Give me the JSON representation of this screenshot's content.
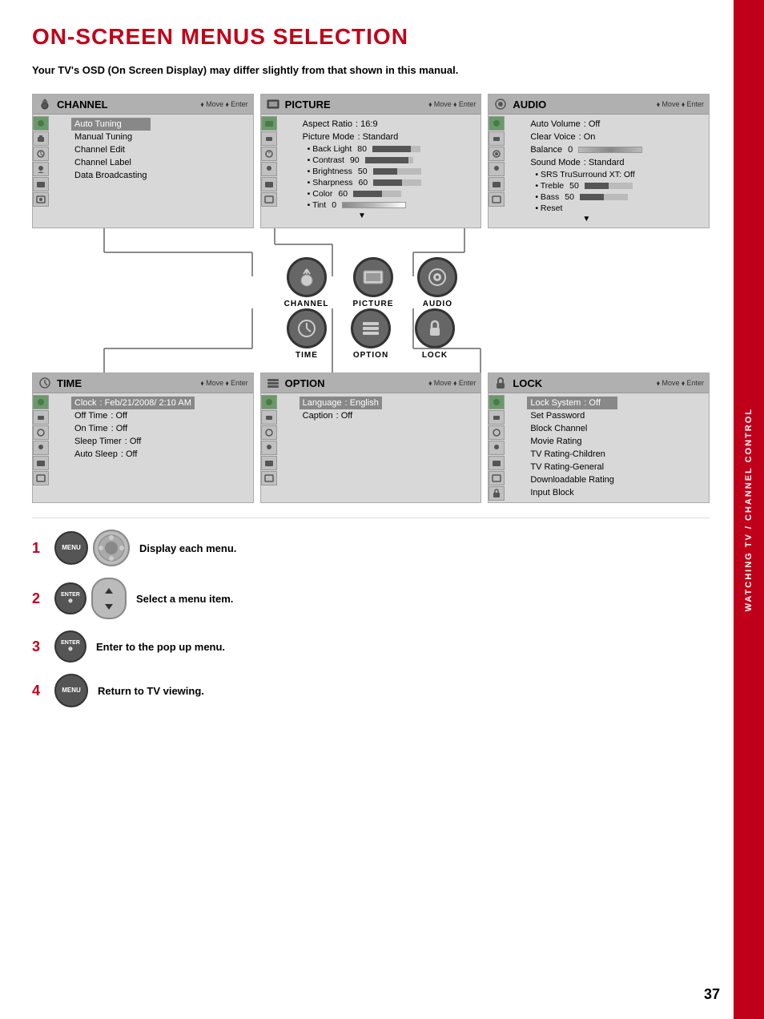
{
  "sidebar": {
    "text": "WATCHING TV / CHANNEL CONTROL"
  },
  "page": {
    "title": "ON-SCREEN MENUS SELECTION",
    "subtitle": "Your TV's OSD (On Screen Display) may differ slightly from that shown in this manual.",
    "page_number": "37"
  },
  "panels": {
    "top_row": [
      {
        "id": "channel",
        "title": "CHANNEL",
        "nav": "Move  Enter",
        "items": [
          {
            "label": "Auto Tuning",
            "value": "",
            "type": "item"
          },
          {
            "label": "Manual Tuning",
            "value": "",
            "type": "item"
          },
          {
            "label": "Channel Edit",
            "value": "",
            "type": "item"
          },
          {
            "label": "Channel Label",
            "value": "",
            "type": "item"
          },
          {
            "label": "Data Broadcasting",
            "value": "",
            "type": "item"
          }
        ]
      },
      {
        "id": "picture",
        "title": "PICTURE",
        "nav": "Move  Enter",
        "items": [
          {
            "label": "Aspect Ratio",
            "value": ": 16:9",
            "type": "header-item"
          },
          {
            "label": "Picture Mode",
            "value": ": Standard",
            "type": "header-item"
          },
          {
            "label": "• Back Light",
            "value": "80",
            "type": "sub",
            "bar": 80
          },
          {
            "label": "• Contrast",
            "value": "90",
            "type": "sub",
            "bar": 90
          },
          {
            "label": "• Brightness",
            "value": "50",
            "type": "sub",
            "bar": 50
          },
          {
            "label": "• Sharpness",
            "value": "60",
            "type": "sub",
            "bar": 60
          },
          {
            "label": "• Color",
            "value": "60",
            "type": "sub",
            "bar": 60
          },
          {
            "label": "• Tint",
            "value": "0",
            "type": "sub-tint"
          }
        ]
      },
      {
        "id": "audio",
        "title": "AUDIO",
        "nav": "Move  Enter",
        "items": [
          {
            "label": "Auto Volume",
            "value": ": Off",
            "type": "header-item"
          },
          {
            "label": "Clear Voice",
            "value": ": On",
            "type": "header-item"
          },
          {
            "label": "Balance",
            "value": "0",
            "type": "balance"
          },
          {
            "label": "Sound Mode",
            "value": ": Standard",
            "type": "header-item"
          },
          {
            "label": "• SRS TruSurround XT: Off",
            "value": "",
            "type": "sub-nobar"
          },
          {
            "label": "• Treble",
            "value": "50",
            "type": "sub",
            "bar": 50
          },
          {
            "label": "• Bass",
            "value": "50",
            "type": "sub",
            "bar": 50
          },
          {
            "label": "• Reset",
            "value": "",
            "type": "sub-nobar"
          }
        ]
      }
    ],
    "middle_icons": [
      {
        "id": "channel",
        "label": "CHANNEL",
        "symbol": "📡"
      },
      {
        "id": "picture",
        "label": "PICTURE",
        "symbol": "🖥"
      },
      {
        "id": "audio",
        "label": "AUDIO",
        "symbol": "🔊"
      }
    ],
    "bottom_icons": [
      {
        "id": "time",
        "label": "TIME",
        "symbol": "⏰"
      },
      {
        "id": "option",
        "label": "OPTION",
        "symbol": "⚙"
      },
      {
        "id": "lock",
        "label": "LOCK",
        "symbol": "🔒"
      }
    ],
    "bottom_row": [
      {
        "id": "time",
        "title": "TIME",
        "nav": "Move  Enter",
        "items": [
          {
            "label": "Clock",
            "value": ": Feb/21/2008/  2:10 AM",
            "type": "header-item"
          },
          {
            "label": "Off Time",
            "value": ": Off",
            "type": "header-item"
          },
          {
            "label": "On Time",
            "value": ": Off",
            "type": "header-item"
          },
          {
            "label": "Sleep Timer",
            "value": ": Off",
            "type": "header-item"
          },
          {
            "label": "Auto Sleep",
            "value": ": Off",
            "type": "header-item"
          }
        ]
      },
      {
        "id": "option",
        "title": "OPTION",
        "nav": "Move  Enter",
        "items": [
          {
            "label": "Language",
            "value": ": English",
            "type": "header-item"
          },
          {
            "label": "Caption",
            "value": ": Off",
            "type": "header-item"
          }
        ]
      },
      {
        "id": "lock",
        "title": "LOCK",
        "nav": "Move  Enter",
        "items": [
          {
            "label": "Lock System",
            "value": ": Off",
            "type": "header-item"
          },
          {
            "label": "Set Password",
            "value": "",
            "type": "item"
          },
          {
            "label": "Block Channel",
            "value": "",
            "type": "item"
          },
          {
            "label": "Movie Rating",
            "value": "",
            "type": "item"
          },
          {
            "label": "TV Rating-Children",
            "value": "",
            "type": "item"
          },
          {
            "label": "TV Rating-General",
            "value": "",
            "type": "item"
          },
          {
            "label": "Downloadable Rating",
            "value": "",
            "type": "item"
          },
          {
            "label": "Input Block",
            "value": "",
            "type": "item"
          }
        ]
      }
    ]
  },
  "steps": [
    {
      "number": "1",
      "button": "MENU",
      "description": "Display each menu."
    },
    {
      "number": "2",
      "button": "ENTER",
      "description": "Select a menu item."
    },
    {
      "number": "3",
      "button": "ENTER",
      "description": "Enter to the pop up menu."
    },
    {
      "number": "4",
      "button": "MENU",
      "description": "Return to TV viewing."
    }
  ]
}
